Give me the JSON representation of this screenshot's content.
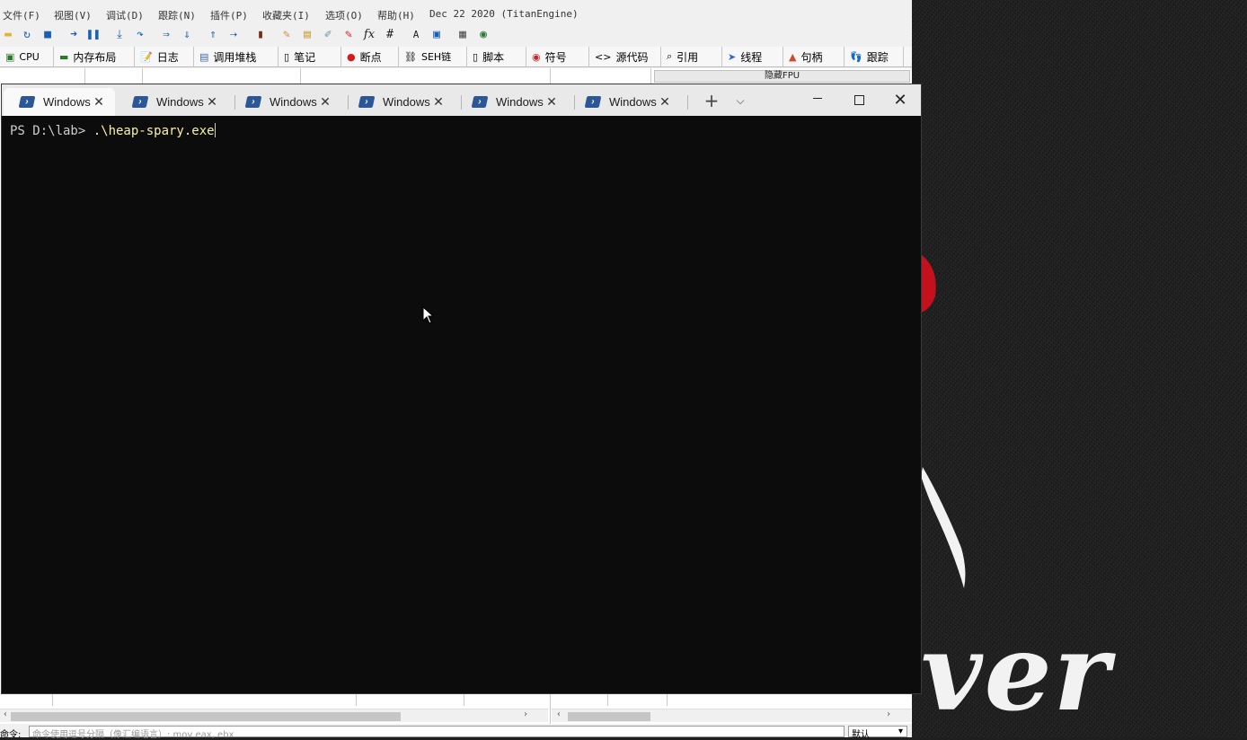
{
  "debugger": {
    "menu": [
      "文件(F)",
      "视图(V)",
      "调试(D)",
      "跟踪(N)",
      "插件(P)",
      "收藏夹(I)",
      "选项(O)",
      "帮助(H)",
      "Dec 22 2020 (TitanEngine)"
    ],
    "toolbar_icons": [
      "open-icon",
      "restart-icon",
      "stop-icon",
      "run-icon",
      "pause-icon",
      "step-into-icon",
      "step-over-icon",
      "trace-into-icon",
      "trace-over-icon",
      "run-to-user-icon",
      "execute-till-return-icon",
      "script-icon",
      "patch-icon",
      "comment-icon",
      "label-icon",
      "bookmark-icon",
      "function-icon",
      "hash-icon",
      "font-icon",
      "memory-icon",
      "calculator-icon",
      "globe-icon"
    ],
    "tabs": [
      {
        "label": "CPU",
        "icon": "cpu-icon"
      },
      {
        "label": "内存布局",
        "icon": "memory-map-icon"
      },
      {
        "label": "日志",
        "icon": "log-icon"
      },
      {
        "label": "调用堆栈",
        "icon": "callstack-icon"
      },
      {
        "label": "笔记",
        "icon": "notes-icon"
      },
      {
        "label": "断点",
        "icon": "breakpoint-icon"
      },
      {
        "label": "SEH链",
        "icon": "seh-icon"
      },
      {
        "label": "脚本",
        "icon": "script-icon"
      },
      {
        "label": "符号",
        "icon": "symbol-icon"
      },
      {
        "label": "源代码",
        "icon": "source-icon"
      },
      {
        "label": "引用",
        "icon": "reference-icon"
      },
      {
        "label": "线程",
        "icon": "thread-icon"
      },
      {
        "label": "句柄",
        "icon": "handle-icon"
      },
      {
        "label": "跟踪",
        "icon": "trace-icon"
      }
    ],
    "fpu_label": "隐藏FPU",
    "command_label": "命令:",
    "command_placeholder": "命令使用逗号分隔（像汇编语言）: mov eax, ebx",
    "command_mode": "默认"
  },
  "terminal": {
    "tabs": [
      {
        "title": "Windows",
        "active": true
      },
      {
        "title": "Windows",
        "active": false
      },
      {
        "title": "Windows",
        "active": false
      },
      {
        "title": "Windows",
        "active": false
      },
      {
        "title": "Windows",
        "active": false
      },
      {
        "title": "Windows",
        "active": false
      }
    ],
    "new_tab_symbol": "+",
    "dropdown_symbol": "⌵",
    "close_symbol": "✕",
    "prompt": "PS D:\\lab> ",
    "command": ".\\heap-spary.exe",
    "colors": {
      "background": "#0c0c0c",
      "text": "#cccccc",
      "command": "#f9f1a5",
      "titlebar": "#e9e9e9"
    }
  },
  "wallpaper": {
    "text": "ver"
  }
}
